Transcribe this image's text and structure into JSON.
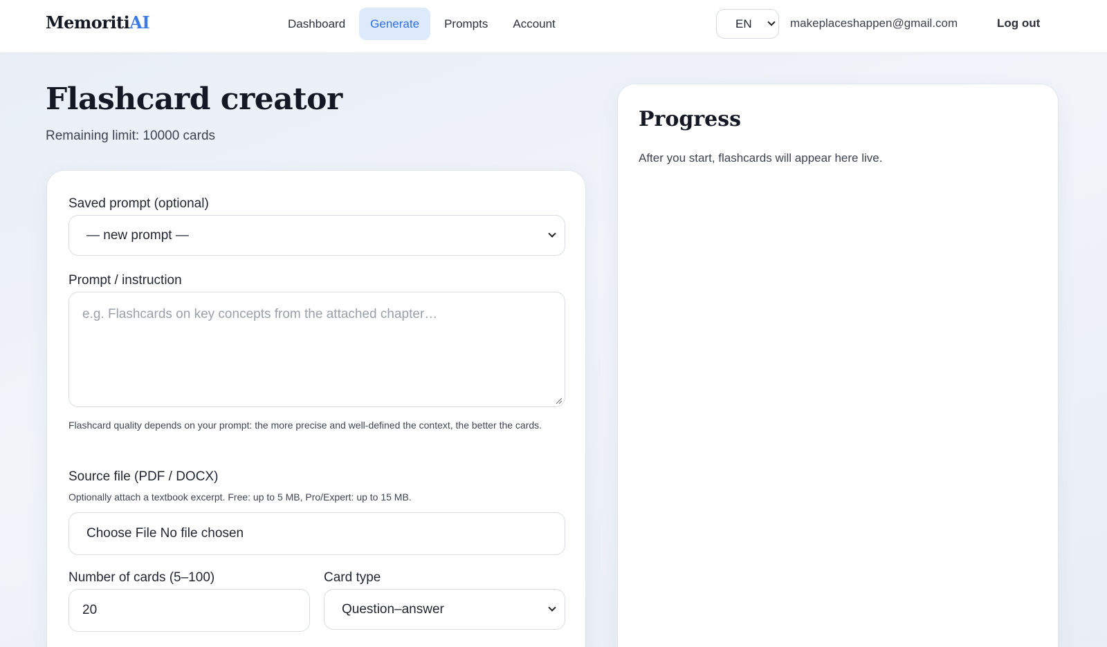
{
  "brand": {
    "name_part1": "Memoriti",
    "name_part2": "AI"
  },
  "nav": {
    "items": [
      {
        "label": "Dashboard",
        "active": false
      },
      {
        "label": "Generate",
        "active": true
      },
      {
        "label": "Prompts",
        "active": false
      },
      {
        "label": "Account",
        "active": false
      }
    ]
  },
  "header": {
    "language": "EN",
    "email": "makeplaceshappen@gmail.com",
    "logout_label": "Log out"
  },
  "page": {
    "title": "Flashcard creator",
    "limit_text": "Remaining limit: 10000 cards"
  },
  "form": {
    "saved_prompt_label": "Saved prompt (optional)",
    "saved_prompt_value": "— new prompt —",
    "prompt_label": "Prompt / instruction",
    "prompt_placeholder": "e.g. Flashcards on key concepts from the attached chapter…",
    "prompt_help": "Flashcard quality depends on your prompt: the more precise and well-defined the context, the better the cards.",
    "source_label": "Source file (PDF / DOCX)",
    "source_help": "Optionally attach a textbook excerpt. Free: up to 5 MB, Pro/Expert: up to 15 MB.",
    "file_button": "Choose File",
    "file_status": "No file chosen",
    "cards_label": "Number of cards (5–100)",
    "cards_value": "20",
    "card_type_label": "Card type",
    "card_type_value": "Question–answer"
  },
  "progress": {
    "title": "Progress",
    "empty_text": "After you start, flashcards will appear here live."
  },
  "colors": {
    "accent": "#2f6fe0",
    "active_tab_bg": "#dceafb",
    "brand_ai": "#3a7be6"
  }
}
